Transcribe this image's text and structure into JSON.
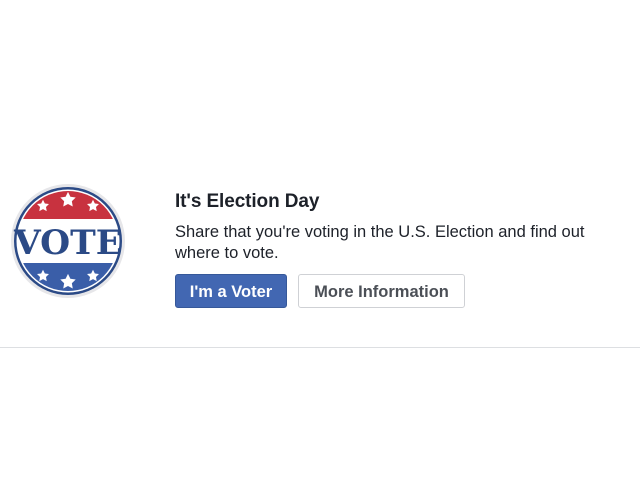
{
  "prompt": {
    "title": "It's Election Day",
    "description": "Share that you're voting in the U.S. Election and find out where to vote.",
    "badge": {
      "text": "VOTE",
      "icon": "vote-badge-icon",
      "colors": {
        "red": "#c8323f",
        "blue": "#2b4a86",
        "white": "#ffffff"
      }
    },
    "buttons": {
      "primary_label": "I'm a Voter",
      "secondary_label": "More Information"
    },
    "colors": {
      "primary_button": "#4267b2",
      "text": "#1d2129",
      "secondary_text": "#4b4f56",
      "divider": "#dddfe2"
    }
  }
}
